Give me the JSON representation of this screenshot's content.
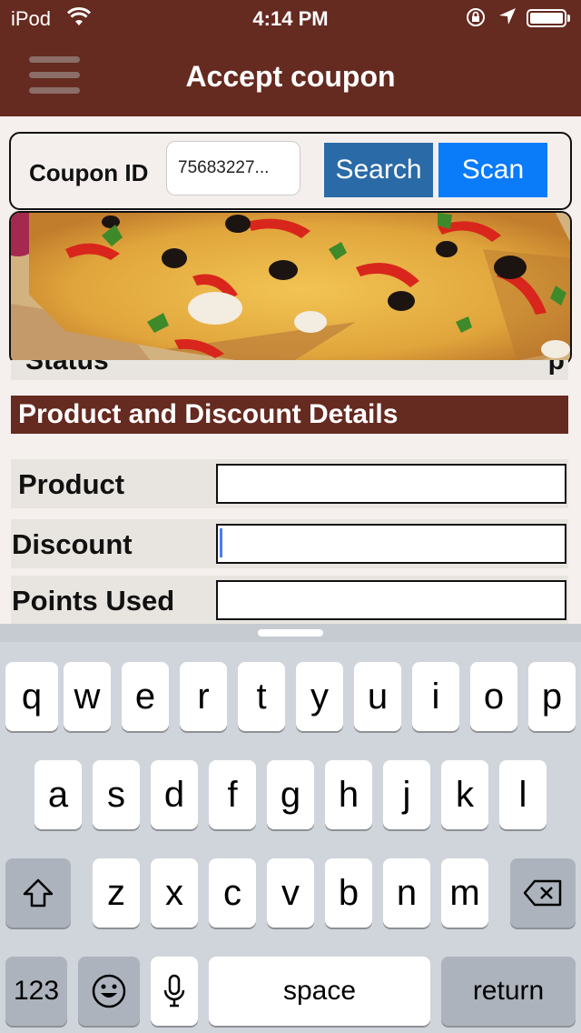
{
  "status_bar": {
    "carrier": "iPod",
    "wifi_icon": "wifi-icon",
    "time": "4:14 PM",
    "rotation_lock_icon": "rotation-lock-icon",
    "location_icon": "location-arrow-icon",
    "battery_icon": "battery-icon"
  },
  "nav": {
    "title": "Accept coupon",
    "menu_icon": "hamburger-menu-icon"
  },
  "coupon": {
    "label": "Coupon ID",
    "value": "75683227...",
    "search_label": "Search",
    "scan_label": "Scan"
  },
  "banner": {
    "image": "pizza-photo"
  },
  "status_row": {
    "label": "Status",
    "value": "p"
  },
  "section": {
    "title": "Product and Discount Details"
  },
  "form": {
    "product_label": "Product",
    "product_value": "",
    "discount_label": "Discount",
    "discount_value": "",
    "points_label": "Points Used",
    "points_value": ""
  },
  "keyboard": {
    "row1": [
      "q",
      "w",
      "e",
      "r",
      "t",
      "y",
      "u",
      "i",
      "o",
      "p"
    ],
    "row2": [
      "a",
      "s",
      "d",
      "f",
      "g",
      "h",
      "j",
      "k",
      "l"
    ],
    "row3": [
      "z",
      "x",
      "c",
      "v",
      "b",
      "n",
      "m"
    ],
    "numbers_label": "123",
    "space_label": "space",
    "return_label": "return",
    "shift_icon": "shift-icon",
    "backspace_icon": "backspace-icon",
    "emoji_icon": "emoji-icon",
    "mic_icon": "microphone-icon"
  },
  "colors": {
    "brand": "#652a20",
    "search_button": "#2a6aa7",
    "scan_button": "#0a7bf9"
  }
}
